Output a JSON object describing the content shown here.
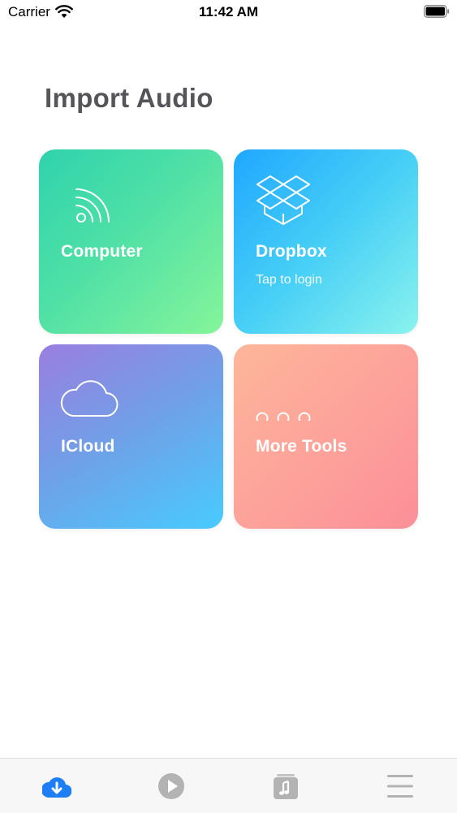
{
  "status_bar": {
    "carrier": "Carrier",
    "time": "11:42 AM"
  },
  "page": {
    "title": "Import Audio"
  },
  "tiles": [
    {
      "label": "Computer",
      "icon": "wifi-signal-icon"
    },
    {
      "label": "Dropbox",
      "sublabel": "Tap to login",
      "icon": "dropbox-icon"
    },
    {
      "label": "ICloud",
      "icon": "cloud-icon"
    },
    {
      "label": "More Tools",
      "icon": "three-dots-icon"
    }
  ],
  "tab_bar": {
    "items": [
      {
        "icon": "cloud-download-icon",
        "active": true
      },
      {
        "icon": "play-circle-icon",
        "active": false
      },
      {
        "icon": "music-album-icon",
        "active": false
      },
      {
        "icon": "menu-lines-icon",
        "active": false
      }
    ]
  },
  "colors": {
    "title": "#555559",
    "tab_active": "#1e7ff5",
    "tab_inactive": "#b3b3b3"
  }
}
